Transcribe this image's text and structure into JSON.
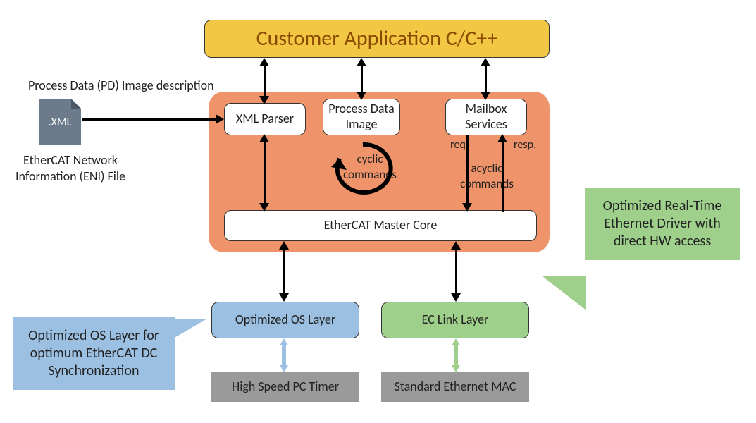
{
  "top": {
    "title": "Customer Application C/C++"
  },
  "eni": {
    "heading": "Process Data (PD) Image description",
    "xml_ext": ".XML",
    "caption": "EtherCAT Network Information (ENI) File"
  },
  "core_group": {
    "xml_parser": "XML Parser",
    "process_data_image": "Process Data Image",
    "mailbox_services": "Mailbox Services",
    "cyclic_commands": "cyclic commands",
    "acyclic_commands": "acyclic commands",
    "req": "req.",
    "resp": "resp.",
    "master_core": "EtherCAT Master Core"
  },
  "os": {
    "optimized_os_layer": "Optimized OS Layer",
    "hs_timer": "High Speed PC Timer"
  },
  "link": {
    "ec_link_layer": "EC Link Layer",
    "std_mac": "Standard Ethernet MAC"
  },
  "callouts": {
    "left": "Optimized OS Layer for optimum EtherCAT DC Synchronization",
    "right": "Optimized Real-Time Ethernet Driver with direct HW access"
  }
}
